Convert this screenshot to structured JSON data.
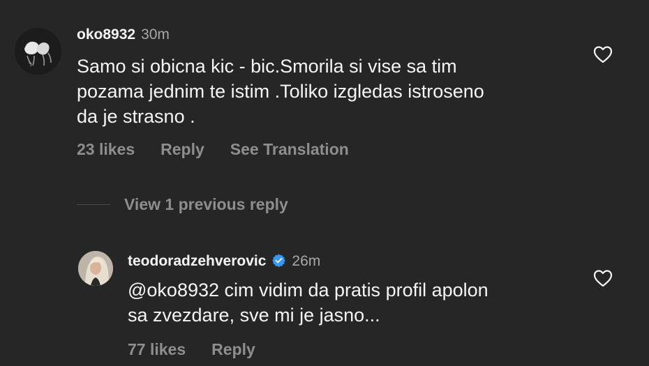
{
  "comments": [
    {
      "username": "oko8932",
      "time": "30m",
      "text": "Samo si obicna kic - bic.Smorila si vise sa tim\npozama jednim te istim .Toliko izgledas istroseno\nda je strasno .",
      "likes": "23 likes",
      "reply": "Reply",
      "translate": "See Translation",
      "avatar_icon": "doodle-avatar",
      "like_icon": "heart-outline-icon"
    }
  ],
  "view_replies": {
    "label": "View 1 previous reply"
  },
  "reply": {
    "username": "teodoradzehverovic",
    "verified": true,
    "verified_color": "#3897f0",
    "time": "26m",
    "text": "@oko8932 cim vidim da pratis profil apolon\nsa zvezdare, sve mi je jasno...",
    "likes": "77 likes",
    "reply": "Reply",
    "avatar_icon": "photo-avatar",
    "like_icon": "heart-outline-icon"
  },
  "colors": {
    "background": "#262626",
    "primary_text": "#f5f5f5",
    "secondary_text": "#8e8e8e",
    "timestamp": "#a8a8a8"
  }
}
